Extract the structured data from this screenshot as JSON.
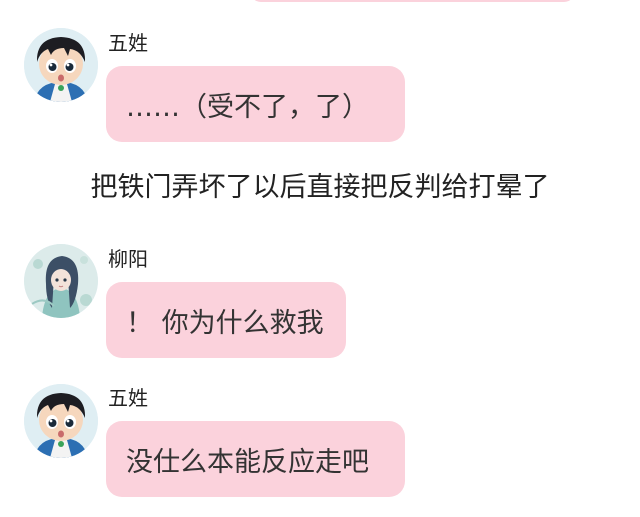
{
  "messages": [
    {
      "sender": "五姓",
      "avatar_icon": "chibi-boy-avatar-icon",
      "text": "……（受不了，了）"
    },
    {
      "sender": "柳阳",
      "avatar_icon": "anime-girl-avatar-icon",
      "text": "！ 你为什么救我"
    },
    {
      "sender": "五姓",
      "avatar_icon": "chibi-boy-avatar-icon",
      "text": "没仕么本能反应走吧"
    }
  ],
  "narration": "把铁门弄坏了以后直接把反判给打晕了",
  "colors": {
    "bubble": "#fbd2dc",
    "background": "#ffffff",
    "text": "#222222"
  }
}
